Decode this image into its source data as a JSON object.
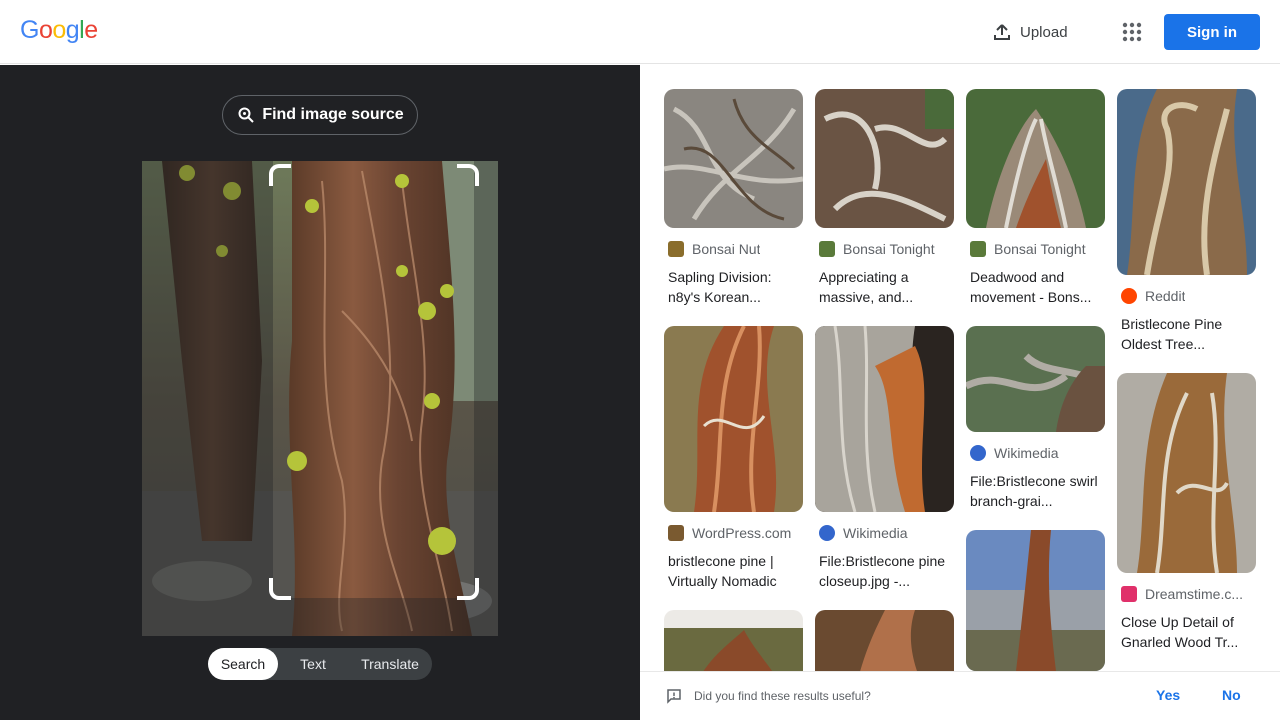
{
  "header": {
    "logo_letters": [
      "G",
      "o",
      "o",
      "g",
      "l",
      "e"
    ],
    "logo_colors": [
      "#4285F4",
      "#EA4335",
      "#FBBC05",
      "#4285F4",
      "#34A853",
      "#EA4335"
    ],
    "upload_label": "Upload",
    "signin_label": "Sign in",
    "icons": {
      "upload": "upload-icon",
      "apps": "apps-grid-icon"
    }
  },
  "lens": {
    "find_source_label": "Find image source",
    "modes": [
      "Search",
      "Text",
      "Translate"
    ],
    "active_mode": "Search"
  },
  "results": [
    {
      "source": "Bonsai Nut",
      "title": "Sapling Division: n8y's Korean...",
      "favicon_color": "#8a6d2c"
    },
    {
      "source": "Bonsai Tonight",
      "title": "Appreciating a massive, and...",
      "favicon_color": "#5a7a3a"
    },
    {
      "source": "Bonsai Tonight",
      "title": "Deadwood and movement - Bons...",
      "favicon_color": "#5a7a3a"
    },
    {
      "source": "Reddit",
      "title": "Bristlecone Pine Oldest Tree...",
      "favicon_color": "#ff4500"
    },
    {
      "source": "WordPress.com",
      "title": "bristlecone pine | Virtually Nomadic",
      "favicon_color": "#7a5a30"
    },
    {
      "source": "Wikimedia",
      "title": "File:Bristlecone pine closeup.jpg -...",
      "favicon_color": "#3366cc"
    },
    {
      "source": "Wikimedia",
      "title": "File:Bristlecone swirl branch-grai...",
      "favicon_color": "#3366cc"
    },
    {
      "source": "Dreamstime.c...",
      "title": "Close Up Detail of Gnarled Wood Tr...",
      "favicon_color": "#e0306a"
    }
  ],
  "feedback": {
    "question": "Did you find these results useful?",
    "yes": "Yes",
    "no": "No"
  }
}
